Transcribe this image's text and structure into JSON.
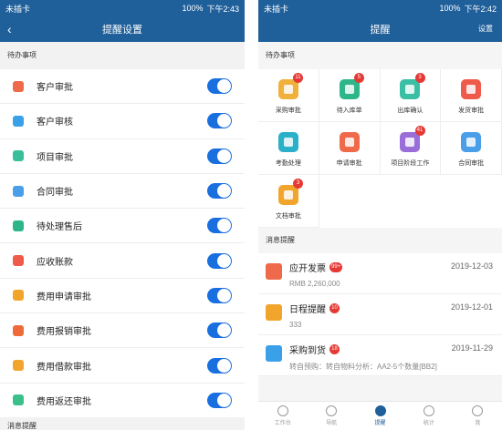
{
  "left_screen": {
    "status": {
      "carrier": "未插卡",
      "battery": "100%",
      "time": "下午2:43"
    },
    "nav": {
      "back": "‹",
      "title": "提醒设置"
    },
    "section_title": "待办事项",
    "items": [
      {
        "label": "客户审批",
        "icon": "customer-approval-icon",
        "color": "#ef6a4a",
        "enabled": true
      },
      {
        "label": "客户审核",
        "icon": "customer-review-icon",
        "color": "#3aa0e8",
        "enabled": true
      },
      {
        "label": "项目审批",
        "icon": "project-approval-icon",
        "color": "#3bbf9b",
        "enabled": true
      },
      {
        "label": "合同审批",
        "icon": "contract-approval-icon",
        "color": "#4a9fe8",
        "enabled": true
      },
      {
        "label": "待处理售后",
        "icon": "after-sales-icon",
        "color": "#2fb58a",
        "enabled": true
      },
      {
        "label": "应收账款",
        "icon": "receivable-icon",
        "color": "#ef5a4a",
        "enabled": true
      },
      {
        "label": "费用申请审批",
        "icon": "expense-apply-icon",
        "color": "#f2a52c",
        "enabled": true
      },
      {
        "label": "费用报销审批",
        "icon": "expense-reimburse-icon",
        "color": "#ef6a3a",
        "enabled": true
      },
      {
        "label": "费用借款审批",
        "icon": "expense-loan-icon",
        "color": "#f2a52c",
        "enabled": true
      },
      {
        "label": "费用返还审批",
        "icon": "expense-return-icon",
        "color": "#3bbf8b",
        "enabled": true
      }
    ],
    "bottom_title": "消息提醒"
  },
  "right_screen": {
    "status": {
      "carrier": "未插卡",
      "battery": "100%",
      "time": "下午2:42"
    },
    "nav": {
      "title": "提醒",
      "setting": "设置"
    },
    "section_title": "待办事项",
    "tasks": [
      {
        "label": "采购审批",
        "badge": "11",
        "color": "#f0b03c",
        "icon": "purchase-approval-icon"
      },
      {
        "label": "待入库单",
        "badge": "5",
        "color": "#2fb58a",
        "icon": "inbound-icon"
      },
      {
        "label": "出库确认",
        "badge": "3",
        "color": "#3bbfa4",
        "icon": "outbound-icon"
      },
      {
        "label": "发货审批",
        "badge": "",
        "color": "#ef5a4a",
        "icon": "shipping-icon"
      },
      {
        "label": "考勤处理",
        "badge": "",
        "color": "#2ab0c8",
        "icon": "attendance-icon"
      },
      {
        "label": "申请审批",
        "badge": "",
        "color": "#ef6a4a",
        "icon": "application-icon"
      },
      {
        "label": "项目阶段工作",
        "badge": "41",
        "color": "#9a6ed8",
        "icon": "project-stage-icon"
      },
      {
        "label": "合同审批",
        "badge": "",
        "color": "#4a9fe8",
        "icon": "contract-icon"
      },
      {
        "label": "文档审批",
        "badge": "3",
        "color": "#f2a52c",
        "icon": "document-icon"
      }
    ],
    "msg_section_title": "消息提醒",
    "messages": [
      {
        "title": "应开发票",
        "badge": "99+",
        "subtitle": "RMB 2,260,000",
        "date": "2019-12-03",
        "color": "#ef6a4a",
        "icon": "invoice-icon"
      },
      {
        "title": "日程提醒",
        "badge": "10",
        "subtitle": "333",
        "date": "2019-12-01",
        "color": "#f2a52c",
        "icon": "calendar-icon"
      },
      {
        "title": "采购到货",
        "badge": "18",
        "subtitle": "转自预购：转自物料分析：AA2-5个数量[BB2]",
        "date": "2019-11-29",
        "color": "#3aa0e8",
        "icon": "bulb-icon"
      }
    ],
    "tabs": [
      {
        "label": "工作台",
        "active": false
      },
      {
        "label": "导航",
        "active": false
      },
      {
        "label": "提醒",
        "active": true
      },
      {
        "label": "统计",
        "active": false
      },
      {
        "label": "我",
        "active": false
      }
    ]
  }
}
